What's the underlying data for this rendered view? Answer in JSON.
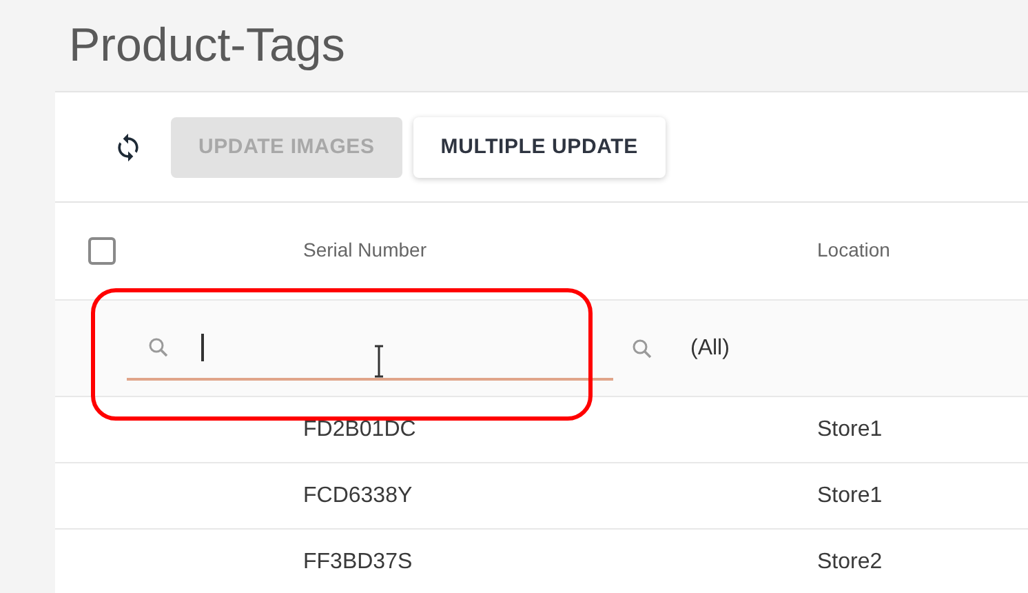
{
  "page_title": "Product-Tags",
  "toolbar": {
    "buttons": [
      {
        "label": "UPDATE IMAGES",
        "disabled": true
      },
      {
        "label": "MULTIPLE UPDATE",
        "disabled": false
      }
    ]
  },
  "table": {
    "select_all": {
      "checked": false
    },
    "columns": [
      "Serial Number",
      "Location"
    ],
    "filters": [
      {
        "kind": "text",
        "focused": true
      },
      {
        "kind": "select",
        "value": "(All)"
      }
    ],
    "rows": [
      {
        "serial_number": "FD2B01DC",
        "location": "Store1"
      },
      {
        "serial_number": "FCD6338Y",
        "location": "Store1"
      },
      {
        "serial_number": "FF3BD37S",
        "location": "Store2"
      }
    ]
  }
}
